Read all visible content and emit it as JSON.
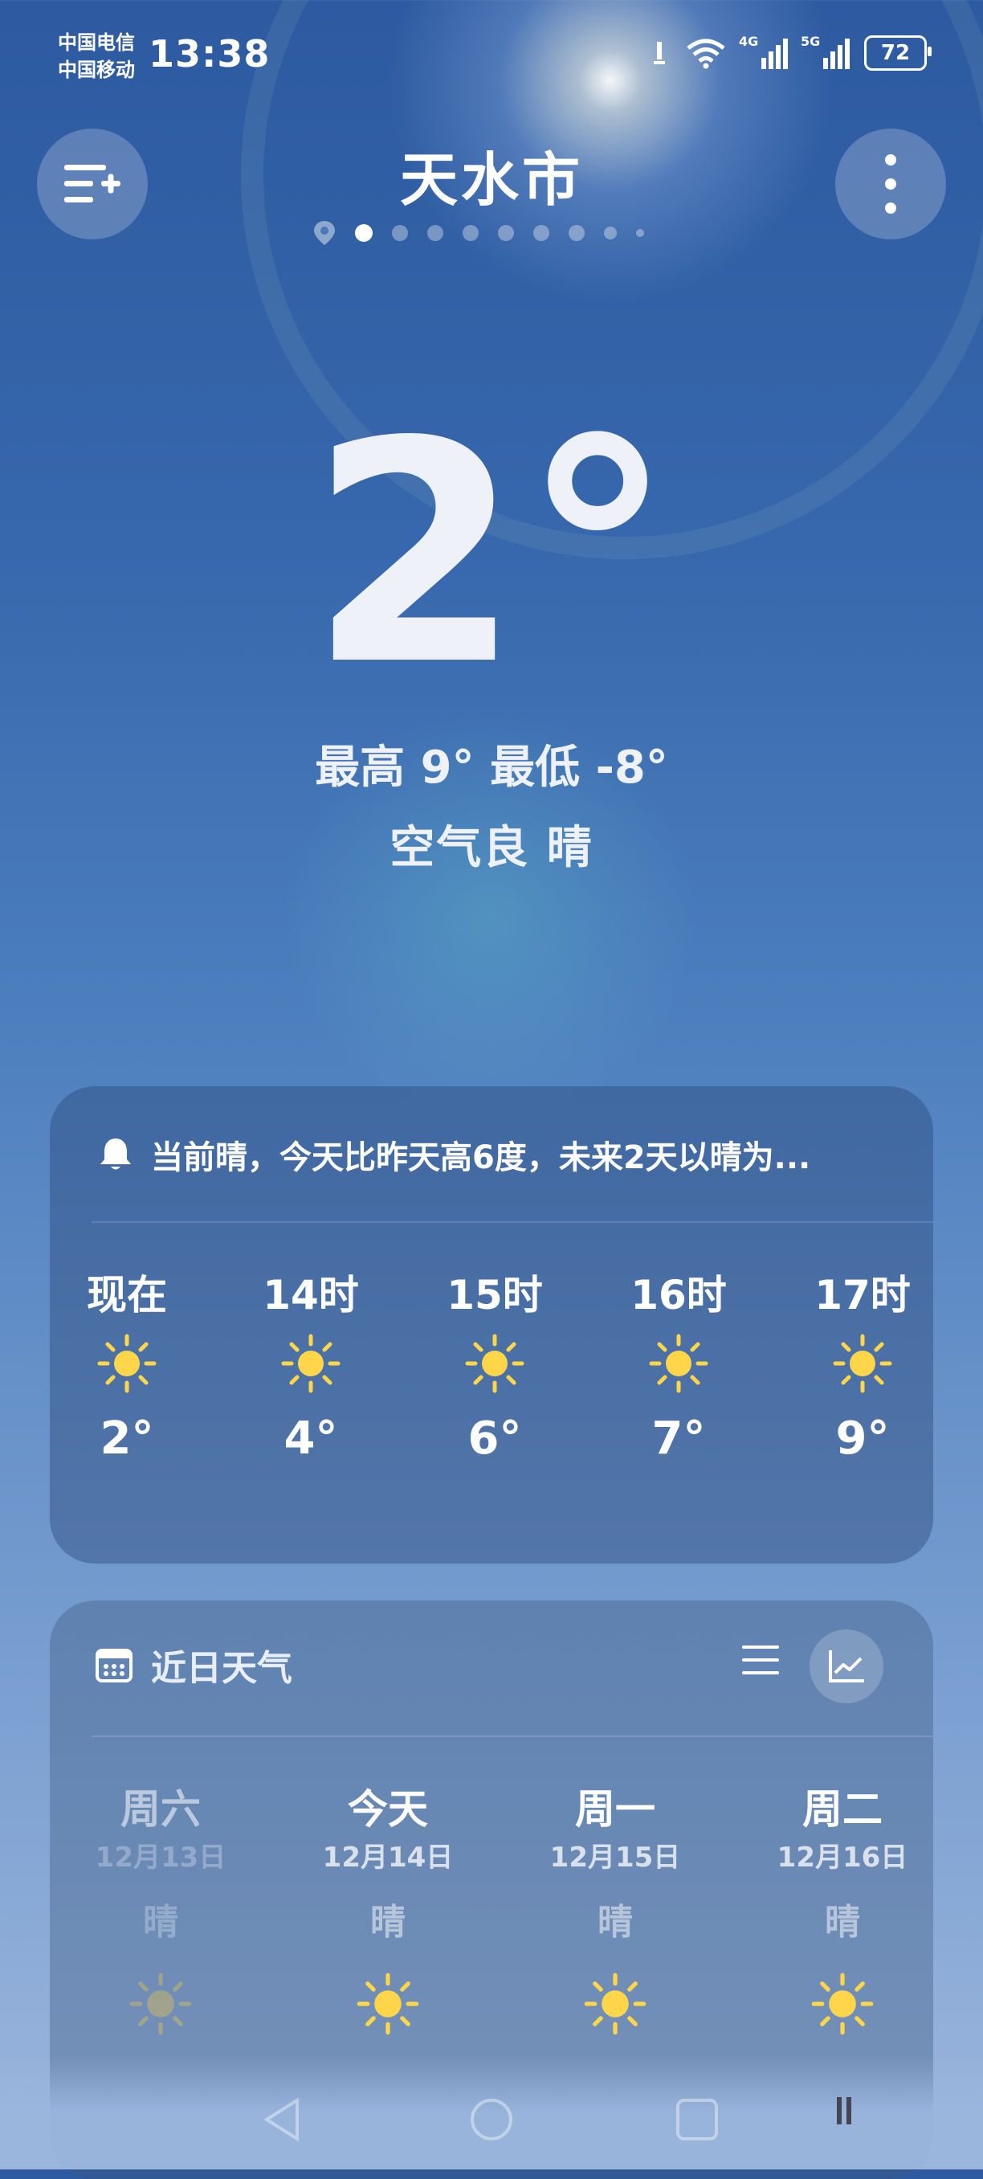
{
  "status_bar": {
    "carrier_1": "中国电信",
    "carrier_2": "中国移动",
    "time": "13:38",
    "network_1": "4G",
    "network_2": "5G",
    "battery": "72"
  },
  "header": {
    "city": "天水市",
    "page_count": 9,
    "active_page": 1
  },
  "current": {
    "temperature": "2°",
    "high_low": "最高 9° 最低 -8°",
    "air_condition": "空气良  晴"
  },
  "hourly_card": {
    "alert": "当前晴，今天比昨天高6度，未来2天以晴为...",
    "hours": [
      {
        "label": "现在",
        "icon": "sun-icon",
        "temp": "2°"
      },
      {
        "label": "14时",
        "icon": "sun-icon",
        "temp": "4°"
      },
      {
        "label": "15时",
        "icon": "sun-icon",
        "temp": "6°"
      },
      {
        "label": "16时",
        "icon": "sun-icon",
        "temp": "7°"
      },
      {
        "label": "17时",
        "icon": "sun-icon",
        "temp": "9°"
      }
    ]
  },
  "daily_card": {
    "title": "近日天气",
    "days": [
      {
        "name": "周六",
        "date": "12月13日",
        "condition": "晴",
        "icon": "sun-icon",
        "faded": true
      },
      {
        "name": "今天",
        "date": "12月14日",
        "condition": "晴",
        "icon": "sun-icon",
        "faded": false
      },
      {
        "name": "周一",
        "date": "12月15日",
        "condition": "晴",
        "icon": "sun-icon",
        "faded": false
      },
      {
        "name": "周二",
        "date": "12月16日",
        "condition": "晴",
        "icon": "sun-icon",
        "faded": false
      }
    ]
  },
  "colors": {
    "sun_yellow": "#ffd54a",
    "sun_faded": "#c9b56a"
  }
}
